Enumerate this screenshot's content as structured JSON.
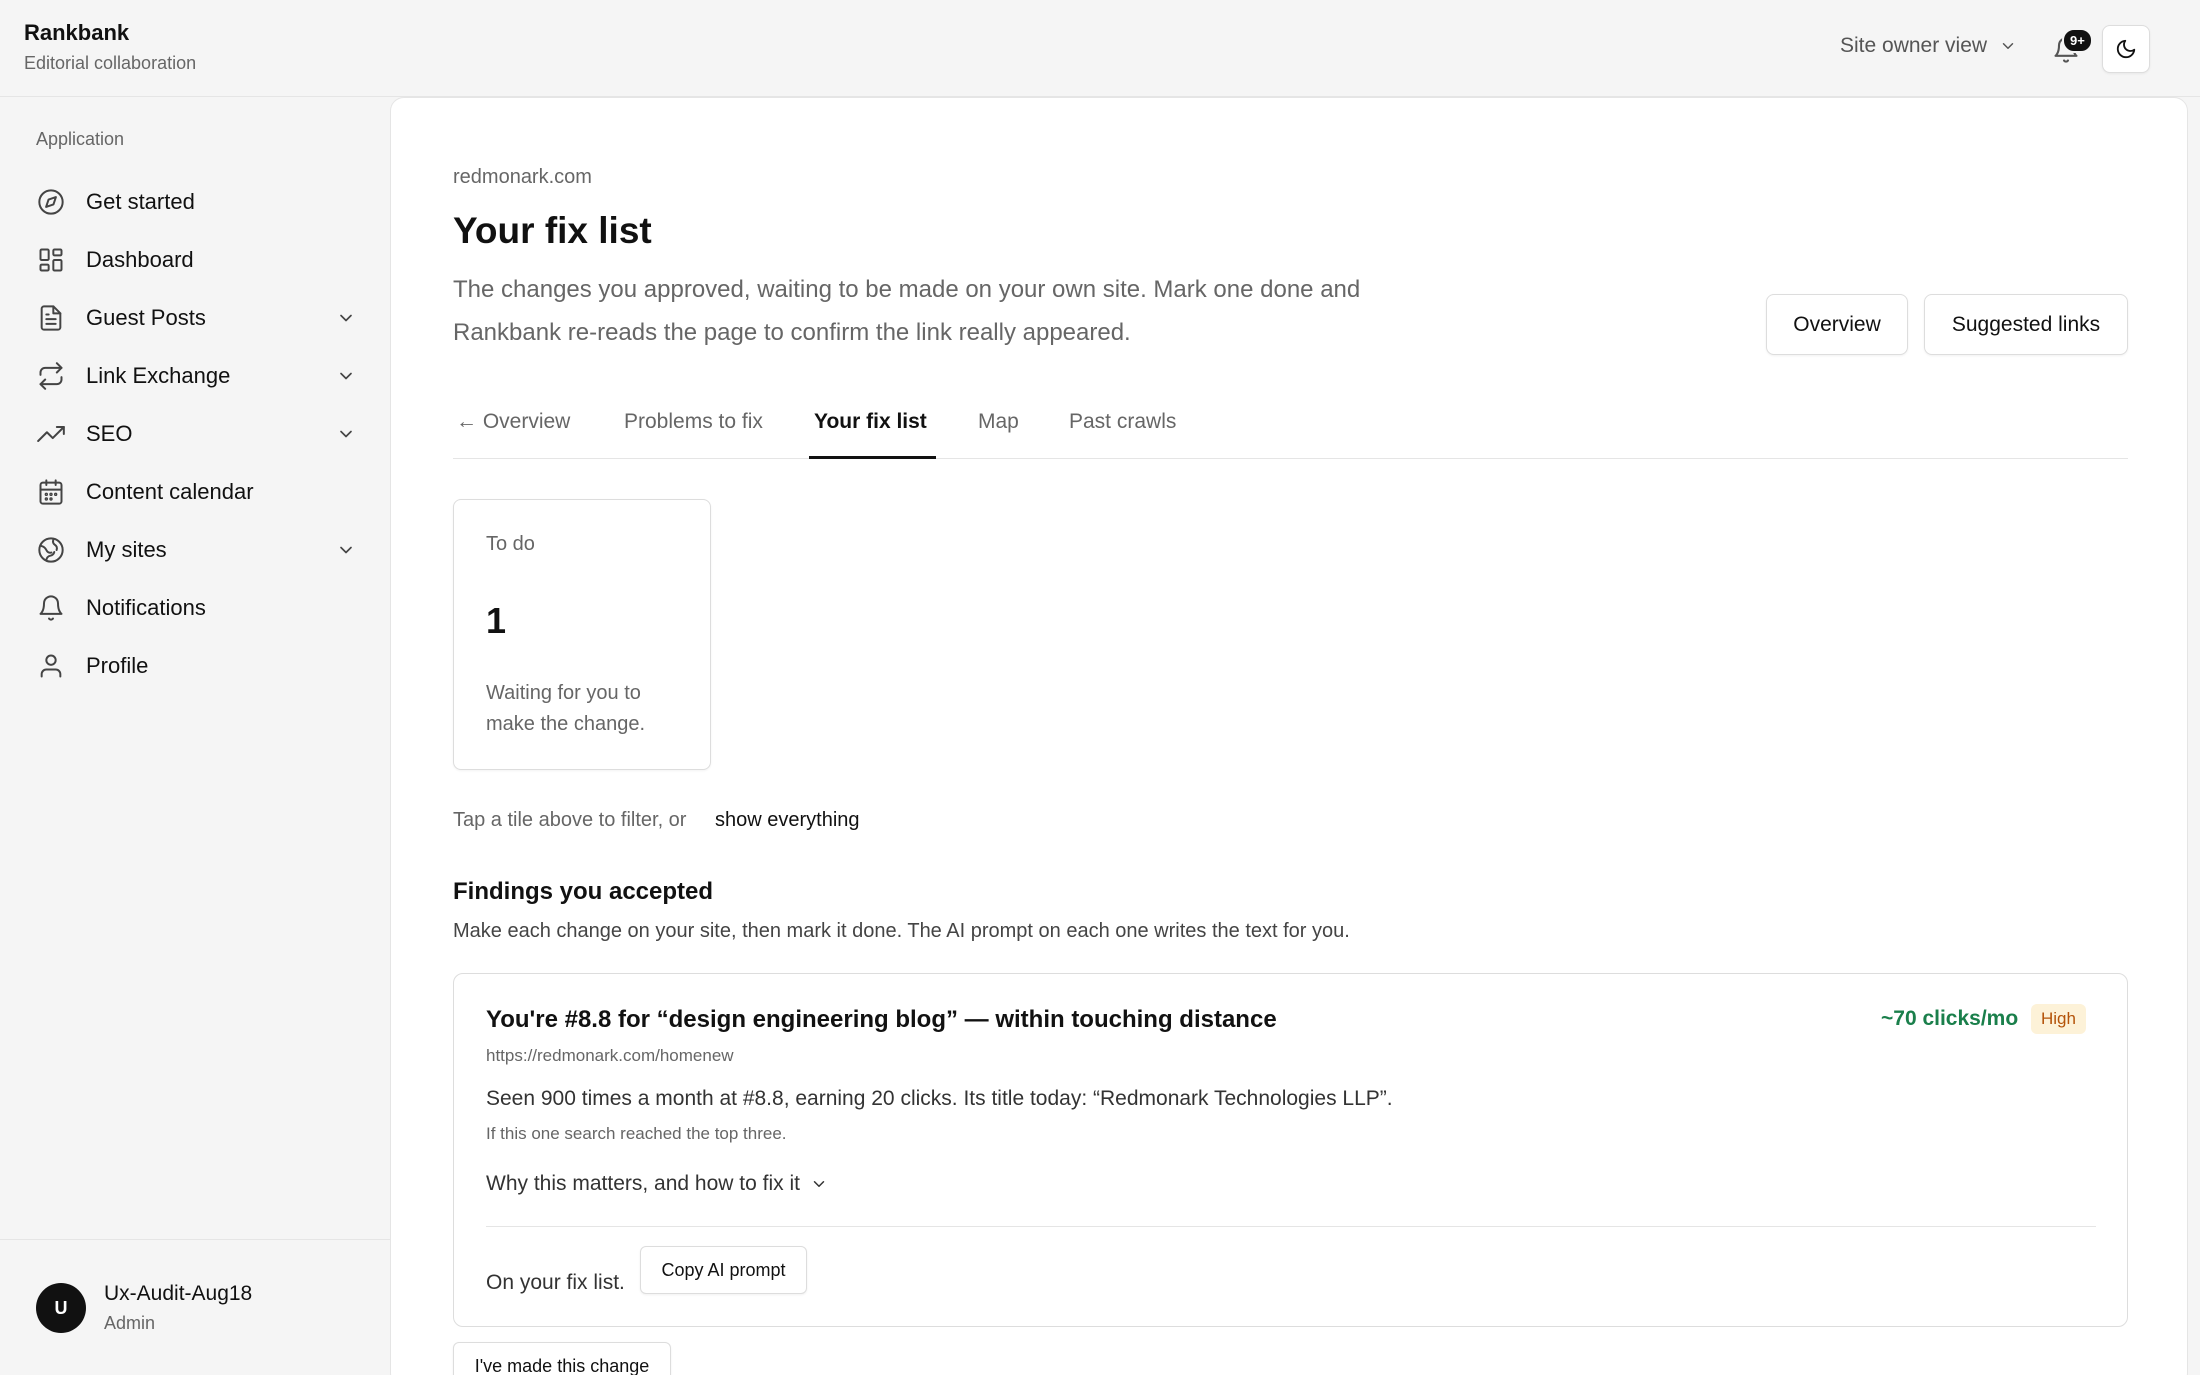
{
  "app": {
    "name": "Rankbank",
    "subtitle": "Editorial collaboration"
  },
  "topbar": {
    "view_label": "Site owner view",
    "notification_badge": "9+"
  },
  "sidebar": {
    "heading": "Application",
    "items": [
      {
        "label": "Get started",
        "icon": "compass-icon",
        "expandable": false
      },
      {
        "label": "Dashboard",
        "icon": "dashboard-grid-icon",
        "expandable": false
      },
      {
        "label": "Guest Posts",
        "icon": "document-icon",
        "expandable": true
      },
      {
        "label": "Link Exchange",
        "icon": "exchange-arrows-icon",
        "expandable": true
      },
      {
        "label": "SEO",
        "icon": "trending-up-icon",
        "expandable": true
      },
      {
        "label": "Content calendar",
        "icon": "calendar-icon",
        "expandable": false
      },
      {
        "label": "My sites",
        "icon": "globe-icon",
        "expandable": true
      },
      {
        "label": "Notifications",
        "icon": "bell-icon",
        "expandable": false
      },
      {
        "label": "Profile",
        "icon": "user-icon",
        "expandable": false
      }
    ],
    "user": {
      "initial": "U",
      "name": "Ux-Audit-Aug18",
      "role": "Admin"
    }
  },
  "main": {
    "domain": "redmonark.com",
    "title": "Your fix list",
    "description": "The changes you approved, waiting to be made on your own site. Mark one done and Rankbank re-reads the page to confirm the link really appeared.",
    "buttons": {
      "overview": "Overview",
      "suggested": "Suggested links"
    },
    "tabs": [
      {
        "label": "← Overview",
        "active": false
      },
      {
        "label": "Problems to fix",
        "active": false
      },
      {
        "label": "Your fix list",
        "active": true
      },
      {
        "label": "Map",
        "active": false
      },
      {
        "label": "Past crawls",
        "active": false
      }
    ],
    "tile": {
      "label": "To do",
      "count": "1",
      "description": "Waiting for you to make the change."
    },
    "filter_hint": "Tap a tile above to filter, or",
    "show_all": "show everything",
    "findings": {
      "title": "Findings you accepted",
      "description": "Make each change on your site, then mark it done. The AI prompt on each one writes the text for you."
    },
    "card": {
      "title": "You're #8.8 for “design engineering blog” — within touching distance",
      "url": "https://redmonark.com/homenew",
      "impact": "~70 clicks/mo",
      "priority": "High",
      "text": "Seen 900 times a month at #8.8, earning 20 clicks. Its title today: “Redmonark Technologies LLP”.",
      "subtext": "If this one search reached the top three.",
      "why_label": "Why this matters, and how to fix it",
      "state_label": "On your fix list.",
      "copy_button": "Copy AI prompt"
    },
    "done_button": "I've made this change"
  },
  "colors": {
    "accent": "#111111",
    "impact_green": "#1a7f4b",
    "badge_bg": "#fdf2d8",
    "badge_text": "#b45309"
  }
}
